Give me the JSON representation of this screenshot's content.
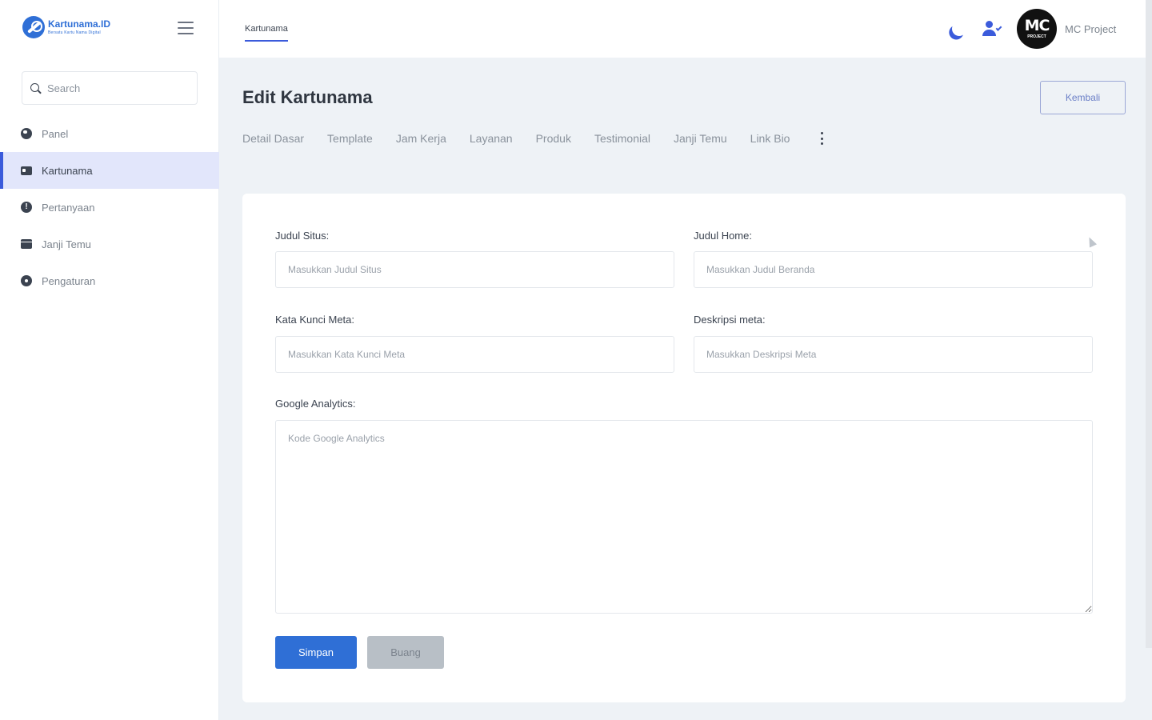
{
  "brand": {
    "name": "Kartunama.ID",
    "tagline": "Bersatu Kartu Nama Digital"
  },
  "sidebar": {
    "search": {
      "placeholder": "Search"
    },
    "items": [
      {
        "label": "Panel",
        "icon": "globe-icon"
      },
      {
        "label": "Kartunama",
        "icon": "card-icon",
        "active": true
      },
      {
        "label": "Pertanyaan",
        "icon": "question-icon"
      },
      {
        "label": "Janji Temu",
        "icon": "calendar-icon"
      },
      {
        "label": "Pengaturan",
        "icon": "gear-icon"
      }
    ]
  },
  "topbar": {
    "tab": "Kartunama",
    "user": {
      "name": "MC Project",
      "avatar_mono": "MC",
      "avatar_sub": "PROJECT"
    },
    "accent": "#3b5bdb"
  },
  "main": {
    "title": "Edit Kartunama",
    "back_label": "Kembali",
    "tabs": [
      "Detail Dasar",
      "Template",
      "Jam Kerja",
      "Layanan",
      "Produk",
      "Testimonial",
      "Janji Temu",
      "Link Bio"
    ],
    "form": {
      "judul_situs": {
        "label": "Judul Situs:",
        "placeholder": "Masukkan Judul Situs",
        "value": ""
      },
      "judul_home": {
        "label": "Judul Home:",
        "placeholder": "Masukkan Judul Beranda",
        "value": ""
      },
      "kata_kunci": {
        "label": "Kata Kunci Meta:",
        "placeholder": "Masukkan Kata Kunci Meta",
        "value": ""
      },
      "deskripsi": {
        "label": "Deskripsi meta:",
        "placeholder": "Masukkan Deskripsi Meta",
        "value": ""
      },
      "analytics": {
        "label": "Google Analytics:",
        "placeholder": "Kode Google Analytics",
        "value": ""
      }
    },
    "save_label": "Simpan",
    "discard_label": "Buang"
  },
  "colors": {
    "primary": "#2f6fd6",
    "active_bg": "#e2e6fb",
    "discard": "#b8bfc6"
  }
}
